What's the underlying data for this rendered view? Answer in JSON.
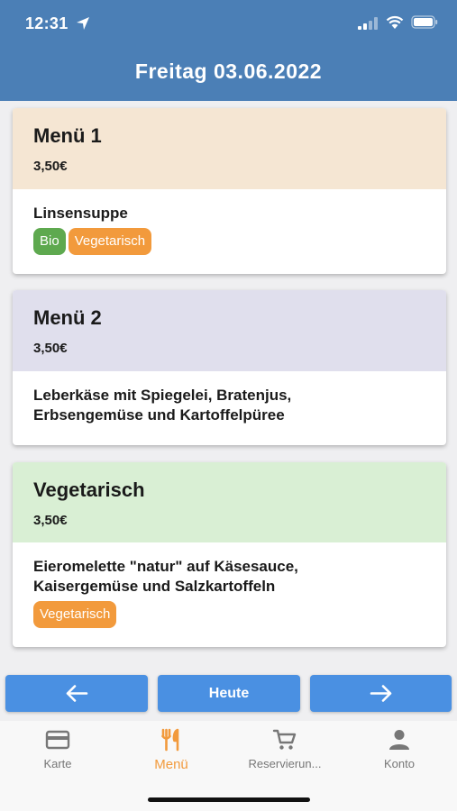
{
  "status_bar": {
    "time": "12:31"
  },
  "header": {
    "title": "Freitag 03.06.2022"
  },
  "menus": [
    {
      "name": "Menü 1",
      "price": "3,50€",
      "description_lines": [
        "Linsensuppe"
      ],
      "tags": [
        "Bio",
        "Vegetarisch"
      ],
      "header_color": "#f5e6d3"
    },
    {
      "name": "Menü 2",
      "price": "3,50€",
      "description_lines": [
        "Leberkäse mit Spiegelei, Bratenjus,",
        "Erbsengemüse und Kartoffelpüree"
      ],
      "tags": [],
      "header_color": "#e0dfed"
    },
    {
      "name": "Vegetarisch",
      "price": "3,50€",
      "description_lines": [
        "Eieromelette \"natur\" auf Käsesauce,",
        "Kaisergemüse und Salzkartoffeln"
      ],
      "tags": [
        "Vegetarisch"
      ],
      "header_color": "#d9efd4"
    }
  ],
  "day_nav": {
    "prev_icon": "arrow-left-icon",
    "today_label": "Heute",
    "next_icon": "arrow-right-icon"
  },
  "tabbar": {
    "items": [
      {
        "label": "Karte",
        "icon": "credit-card-icon",
        "active": false
      },
      {
        "label": "Menü",
        "icon": "fork-knife-icon",
        "active": true
      },
      {
        "label": "Reservierun...",
        "icon": "cart-icon",
        "active": false
      },
      {
        "label": "Konto",
        "icon": "person-icon",
        "active": false
      }
    ]
  },
  "colors": {
    "header": "#4b7fb6",
    "button": "#4a90e2",
    "accent": "#f29a3c",
    "bio": "#5ea94f"
  }
}
